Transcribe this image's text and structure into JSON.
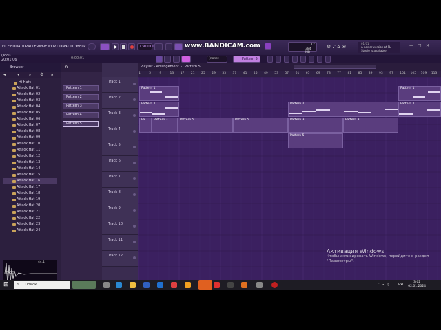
{
  "menubar": {
    "items": [
      "FILE",
      "EDIT",
      "ADD",
      "PATTERNS",
      "VIEW",
      "OPTIONS",
      "TOOLS",
      "HELP"
    ],
    "tempo": "130.000",
    "time": "0:00:01",
    "pattern_name": "Pattern 5",
    "snap": "(none)",
    "bandicam": "www.BANDICAM.com",
    "cpu": "12",
    "memory": "384 MB",
    "news": "A newer version of FL Studio is available!",
    "news_prefix": "01/01"
  },
  "status": {
    "line1": "(Tool)",
    "line2": "20:01:06"
  },
  "browser": {
    "title": "Browser",
    "folder": "Hi Hats",
    "items": [
      "Attack Hat 01",
      "Attack Hat 02",
      "Attack Hat 03",
      "Attack Hat 04",
      "Attack Hat 05",
      "Attack Hat 06",
      "Attack Hat 07",
      "Attack Hat 08",
      "Attack Hat 09",
      "Attack Hat 10",
      "Attack Hat 11",
      "Attack Hat 12",
      "Attack Hat 13",
      "Attack Hat 14",
      "Attack Hat 15",
      "Attack Hat 16",
      "Attack Hat 17",
      "Attack Hat 18",
      "Attack Hat 19",
      "Attack Hat 20",
      "Attack Hat 21",
      "Attack Hat 22",
      "Attack Hat 23",
      "Attack Hat 24"
    ],
    "selected_index": 15,
    "tags_label": "TAGS",
    "wave_info": "44.1"
  },
  "playlist": {
    "title": "Playlist - Arrangement",
    "crumb": "Pattern 5",
    "patterns": [
      "Pattern 1",
      "Pattern 2",
      "Pattern 3",
      "Pattern 4",
      "Pattern 5"
    ],
    "tracks": [
      "Track 1",
      "Track 2",
      "Track 3",
      "Track 4",
      "Track 5",
      "Track 6",
      "Track 7",
      "Track 8",
      "Track 9",
      "Track 10",
      "Track 11",
      "Track 12"
    ],
    "ruler": [
      "1",
      "5",
      "9",
      "13",
      "17",
      "21",
      "25",
      "29",
      "33",
      "37",
      "41",
      "45",
      "49",
      "53",
      "57",
      "61",
      "65",
      "69",
      "73",
      "77",
      "81",
      "85",
      "89",
      "93",
      "97",
      "101",
      "105",
      "109",
      "113"
    ],
    "clip_labels": {
      "p1": "Pattern 1",
      "p2": "Pattern 2",
      "p3": "Pattern 3",
      "p5": "Pattern 5",
      "pa": "Pa..."
    }
  },
  "activation": {
    "title": "Активация Windows",
    "subtitle": "Чтобы активировать Windows, перейдите в раздел \"Параметры\"."
  },
  "taskbar": {
    "search": "Поиск",
    "lang": "РУС",
    "time": "3:02",
    "date": "02.01.2024"
  }
}
